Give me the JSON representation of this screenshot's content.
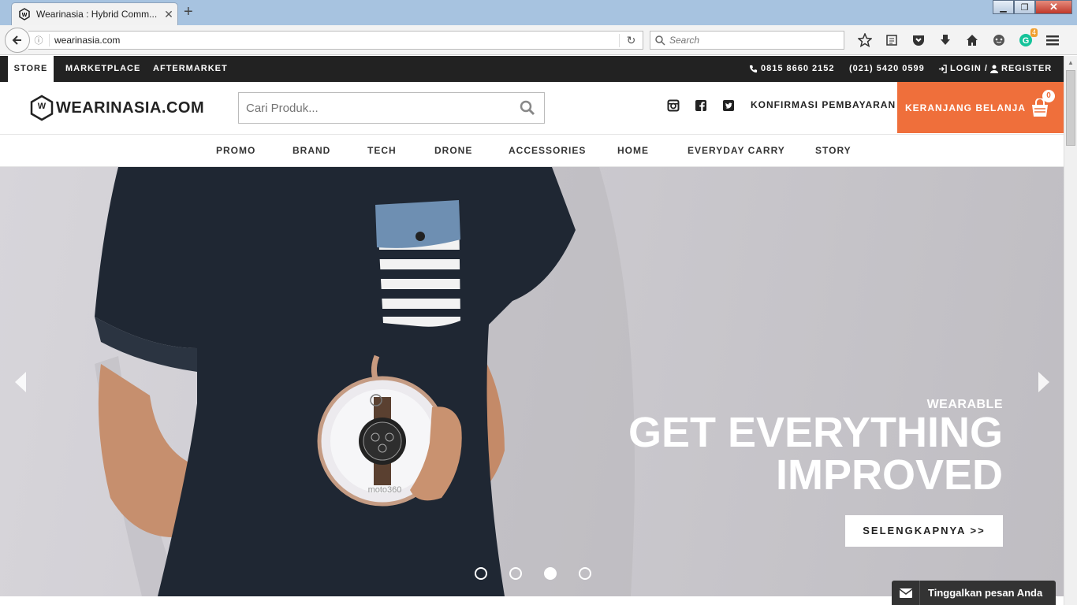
{
  "browser": {
    "tab_title": "Wearinasia : Hybrid Comm...",
    "url": "wearinasia.com",
    "search_placeholder": "Search",
    "badge_count": "4"
  },
  "topbar": {
    "tabs": [
      "STORE",
      "MARKETPLACE",
      "AFTERMARKET"
    ],
    "phone1": "0815 8660 2152",
    "phone2": "(021) 5420 0599",
    "login": "LOGIN /",
    "register": "REGISTER"
  },
  "header": {
    "logo_text": "WEARINASIA.COM",
    "logo_mark": "W",
    "search_placeholder": "Cari Produk...",
    "konfirmasi": "KONFIRMASI PEMBAYARAN",
    "cart_label": "KERANJANG BELANJA",
    "cart_count": "0"
  },
  "nav": {
    "items": [
      "PROMO",
      "BRAND",
      "TECH",
      "DRONE",
      "ACCESSORIES",
      "HOME",
      "EVERYDAY CARRY",
      "STORY"
    ]
  },
  "hero": {
    "eyebrow": "WEARABLE",
    "headline_line1": "GET EVERYTHING",
    "headline_line2": "IMPROVED",
    "button": "SELENGKAPNYA >>",
    "active_slide": 3,
    "slide_count": 4,
    "photo_label": "moto360"
  },
  "chat": {
    "label": "Tinggalkan pesan Anda"
  },
  "colors": {
    "accent": "#ef6f3b",
    "topbar": "#222222"
  }
}
